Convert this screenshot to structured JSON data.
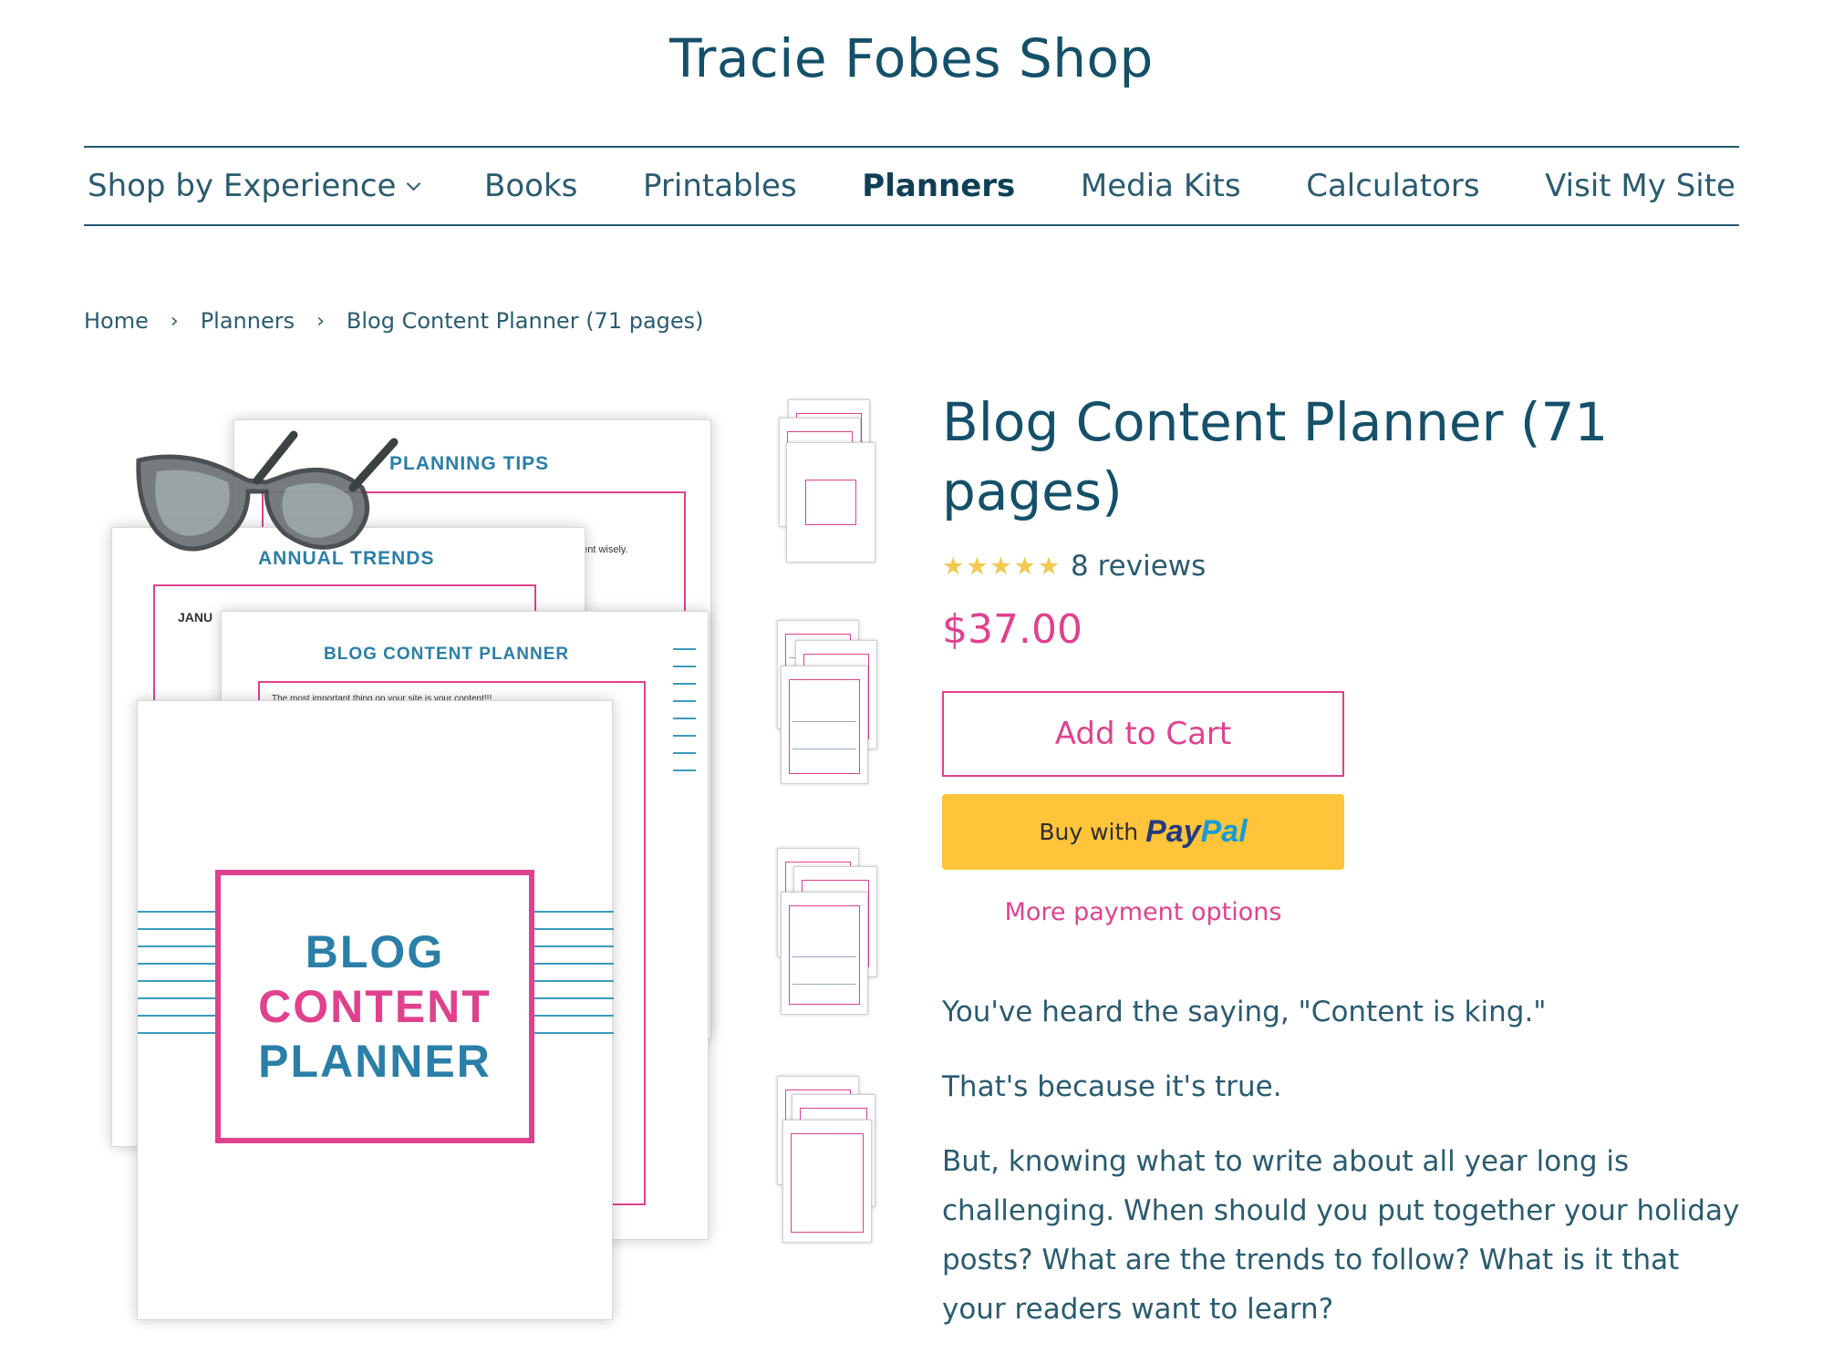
{
  "site": {
    "title": "Tracie Fobes Shop"
  },
  "nav": {
    "items": [
      {
        "label": "Shop by Experience"
      },
      {
        "label": "Books"
      },
      {
        "label": "Printables"
      },
      {
        "label": "Planners"
      },
      {
        "label": "Media Kits"
      },
      {
        "label": "Calculators"
      },
      {
        "label": "Visit My Site"
      }
    ]
  },
  "breadcrumb": {
    "home": "Home",
    "category": "Planners",
    "current": "Blog Content Planner (71 pages)"
  },
  "image": {
    "planning_tips": "PLANNING TIPS",
    "planning_tips_text": "ent ideas to chance. Take the time to plan your content wisely.",
    "annual_trends": "ANNUAL TRENDS",
    "january": "JANU",
    "blog_content_planner_heading": "BLOG CONTENT PLANNER",
    "important_text": "The most important thing on your site is your content!!!",
    "cover_line1": "BLOG",
    "cover_line2": "CONTENT",
    "cover_line3": "PLANNER"
  },
  "product": {
    "title": "Blog Content Planner (71 pages)",
    "stars": "★★★★★",
    "rating_value": 5,
    "reviews": "8 reviews",
    "price": "$37.00",
    "add_to_cart": "Add to Cart",
    "paypal_prefix": "Buy with",
    "paypal_brand_1": "Pay",
    "paypal_brand_2": "Pal",
    "more_payment": "More payment options"
  },
  "description": {
    "p1": "You've heard the saying, \"Content is king.\"",
    "p2": "That's because it's true.",
    "p3": "But, knowing what to write about all year long is challenging. When should you put together your holiday posts? What are the trends to follow?  What is it that your readers want to learn?"
  },
  "colors": {
    "brand": "#14506a",
    "accent_pink": "#e0418f",
    "paypal_yellow": "#ffc439",
    "star": "#f3c94f"
  }
}
